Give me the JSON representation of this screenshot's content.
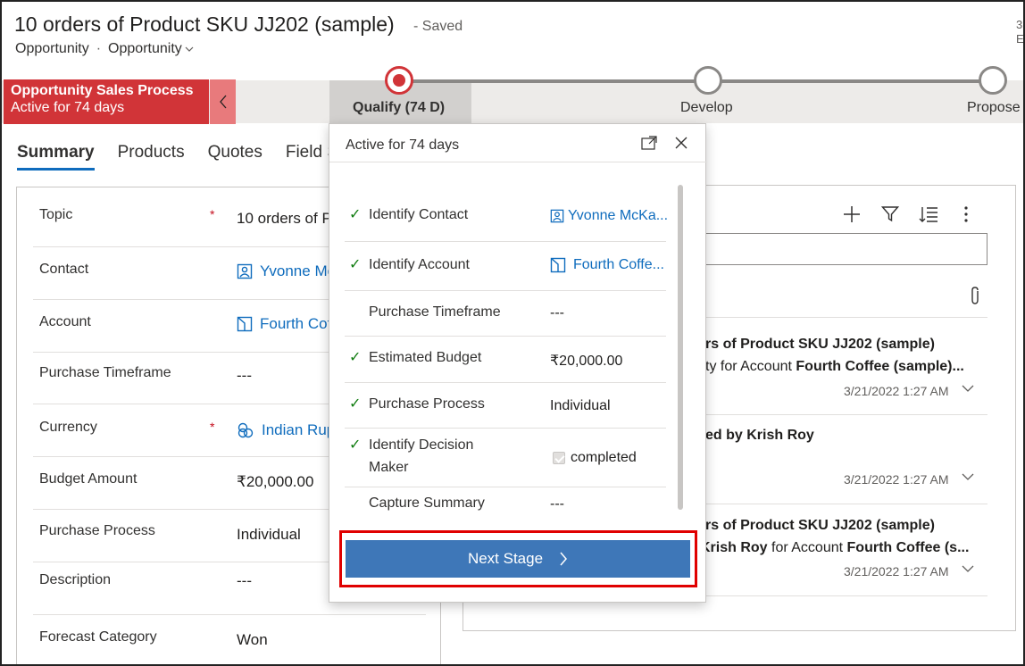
{
  "header": {
    "title": "10 orders of Product SKU JJ202 (sample)",
    "saved": "- Saved",
    "entity": "Opportunity",
    "form_selector": "Opportunity",
    "edge_text_1": "3",
    "edge_text_2": "E"
  },
  "bpf": {
    "process_name": "Opportunity Sales Process",
    "process_active": "Active for 74 days",
    "stages": [
      {
        "label": "Qualify  (74 D)"
      },
      {
        "label": "Develop"
      },
      {
        "label": "Propose"
      }
    ],
    "accent": "#d13438"
  },
  "tabs": [
    {
      "label": "Summary"
    },
    {
      "label": "Products"
    },
    {
      "label": "Quotes"
    },
    {
      "label": "Field S"
    }
  ],
  "form": {
    "rows": [
      {
        "label": "Topic",
        "value": "10 orders of P"
      },
      {
        "label": "Contact",
        "value": "Yvonne Mc"
      },
      {
        "label": "Account",
        "value": "Fourth Cof"
      },
      {
        "label": "Purchase Timeframe",
        "value": "---"
      },
      {
        "label": "Currency",
        "value": "Indian Rup"
      },
      {
        "label": "Budget Amount",
        "value": "₹20,000.00"
      },
      {
        "label": "Purchase Process",
        "value": "Individual"
      },
      {
        "label": "Description",
        "value": "---"
      },
      {
        "label": "Forecast Category",
        "value": "Won"
      }
    ],
    "required_mark": "*"
  },
  "flyout": {
    "header": "Active for 74 days",
    "check_glyph": "✓",
    "steps": [
      {
        "label": "Identify Contact",
        "value": "Yvonne McKa..."
      },
      {
        "label": "Identify Account",
        "value": "Fourth Coffe..."
      },
      {
        "label": "Purchase Timeframe",
        "value": "---"
      },
      {
        "label": "Estimated Budget",
        "value": "₹20,000.00"
      },
      {
        "label": "Purchase Process",
        "value": "Individual"
      },
      {
        "label": "Identify Decision",
        "label2": "Maker",
        "value": "completed"
      },
      {
        "label": "Capture Summary",
        "value": "---"
      }
    ],
    "next_label": "Next Stage"
  },
  "timeline": {
    "items": [
      {
        "line1": "rs of Product SKU JJ202 (sample)",
        "line2_a": "ty for Account ",
        "line2_b": "Fourth Coffee (sample)...",
        "date": "3/21/2022 1:27 AM"
      },
      {
        "line1": "ed by Krish Roy",
        "date": "3/21/2022 1:27 AM"
      },
      {
        "line1": "rs of Product SKU JJ202 (sample)",
        "line2_a": "Krish Roy",
        "line2_mid": " for Account ",
        "line2_b": "Fourth Coffee (s...",
        "date": "3/21/2022 1:27 AM"
      }
    ]
  }
}
